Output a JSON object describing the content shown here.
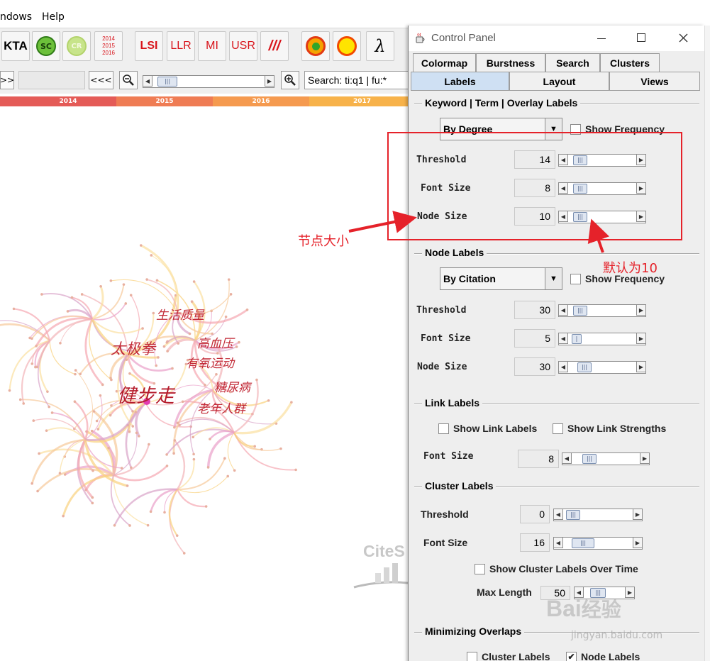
{
  "menu": {
    "windows": "ndows",
    "help": "Help"
  },
  "toolbar": {
    "kta": "KTA",
    "sc": "SC",
    "cr": "CR",
    "years_icon": [
      "2014",
      "2015",
      "2016"
    ],
    "lsi": "LSI",
    "llr": "LLR",
    "mi": "MI",
    "usr": "USR",
    "slashes": "///",
    "lambda": "λ"
  },
  "nav": {
    "forward": ">>",
    "back": "<<<",
    "search_value": "Search: ti:q1 | fu:*"
  },
  "timeline": {
    "years": [
      "2014",
      "2015",
      "2016",
      "2017"
    ],
    "colors": [
      "#e45b57",
      "#ef7c54",
      "#f59a4f",
      "#f7b24a"
    ]
  },
  "graph": {
    "labels": [
      "生活质量",
      "太极拳",
      "高血压",
      "有氧运动",
      "健步走",
      "糖尿病",
      "老年人群"
    ]
  },
  "watermark": {
    "cite": "CiteS",
    "baidu": "Bai",
    "baidu_cn": "经验",
    "site": "jingyan.baidu.com"
  },
  "panel": {
    "title": "Control Panel",
    "tabs_row1": [
      "Colormap",
      "Burstness",
      "Search",
      "Clusters"
    ],
    "tabs_row2": [
      "Labels",
      "Layout",
      "Views"
    ],
    "kw": {
      "title": "Keyword | Term | Overlay Labels",
      "combo": "By Degree",
      "show_freq": "Show Frequency",
      "threshold_label": "Threshold",
      "threshold": "14",
      "font_label": "Font Size",
      "font": "8",
      "node_label": "Node Size",
      "node": "10"
    },
    "node": {
      "title": "Node Labels",
      "combo": "By Citation",
      "show_freq": "Show Frequency",
      "threshold_label": "Threshold",
      "threshold": "30",
      "font_label": "Font Size",
      "font": "5",
      "node_label": "Node Size",
      "node": "30"
    },
    "link": {
      "title": "Link Labels",
      "show_labels": "Show Link Labels",
      "show_strengths": "Show Link Strengths",
      "font_label": "Font Size",
      "font": "8"
    },
    "cluster": {
      "title": "Cluster Labels",
      "threshold_label": "Threshold",
      "threshold": "0",
      "font_label": "Font Size",
      "font": "16",
      "over_time": "Show Cluster Labels Over Time",
      "maxlen_label": "Max Length",
      "maxlen": "50"
    },
    "overlap": {
      "title": "Minimizing Overlaps",
      "cluster_labels": "Cluster Labels",
      "node_labels": "Node Labels"
    }
  },
  "annotations": {
    "node_size": "节点大小",
    "default": "默认为10"
  },
  "colors": {
    "annotation": "#e5222a",
    "active_tab": "#cfe0f3"
  }
}
